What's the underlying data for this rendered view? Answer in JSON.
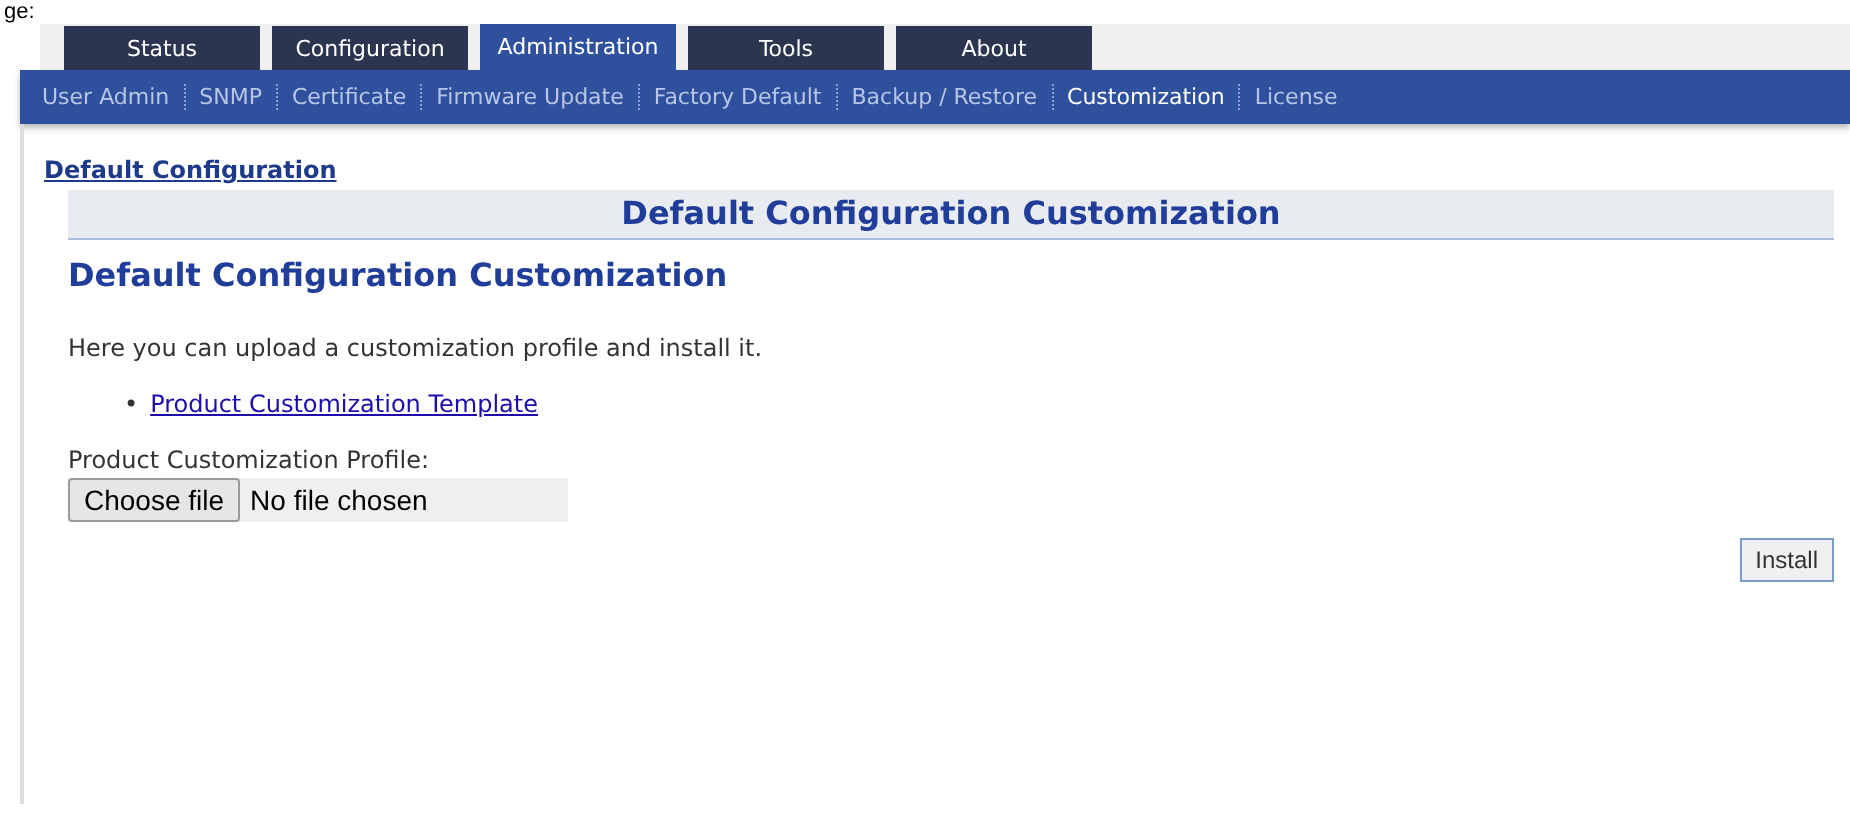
{
  "caption": "ge:",
  "tabs": [
    {
      "label": "Status",
      "selected": false
    },
    {
      "label": "Configuration",
      "selected": false
    },
    {
      "label": "Administration",
      "selected": true
    },
    {
      "label": "Tools",
      "selected": false
    },
    {
      "label": "About",
      "selected": false
    }
  ],
  "subnav": [
    {
      "label": "User Admin",
      "selected": false
    },
    {
      "label": "SNMP",
      "selected": false
    },
    {
      "label": "Certificate",
      "selected": false
    },
    {
      "label": "Firmware Update",
      "selected": false
    },
    {
      "label": "Factory Default",
      "selected": false
    },
    {
      "label": "Backup / Restore",
      "selected": false
    },
    {
      "label": "Customization",
      "selected": true
    },
    {
      "label": "License",
      "selected": false
    }
  ],
  "breadcrumb": "Default Configuration",
  "panel_title": "Default Configuration Customization",
  "heading": "Default Configuration Customization",
  "description": "Here you can upload a customization profile and install it.",
  "links": [
    {
      "bullet": "•",
      "label": "Product Customization Template"
    }
  ],
  "file_field": {
    "label": "Product Customization Profile:",
    "button": "Choose file",
    "value": "No file chosen"
  },
  "install_button": "Install"
}
